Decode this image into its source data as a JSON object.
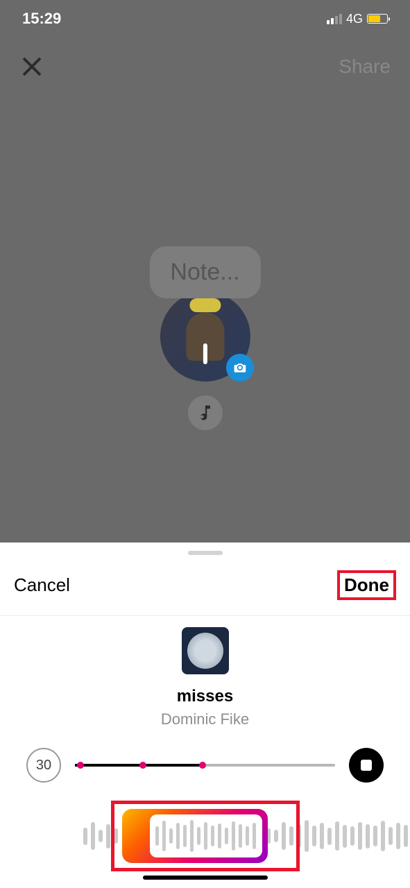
{
  "status": {
    "time": "15:29",
    "network": "4G"
  },
  "top": {
    "share": "Share"
  },
  "note": {
    "placeholder": "Note..."
  },
  "sheet": {
    "cancel": "Cancel",
    "done": "Done"
  },
  "song": {
    "title": "misses",
    "artist": "Dominic Fike",
    "duration": "30"
  }
}
